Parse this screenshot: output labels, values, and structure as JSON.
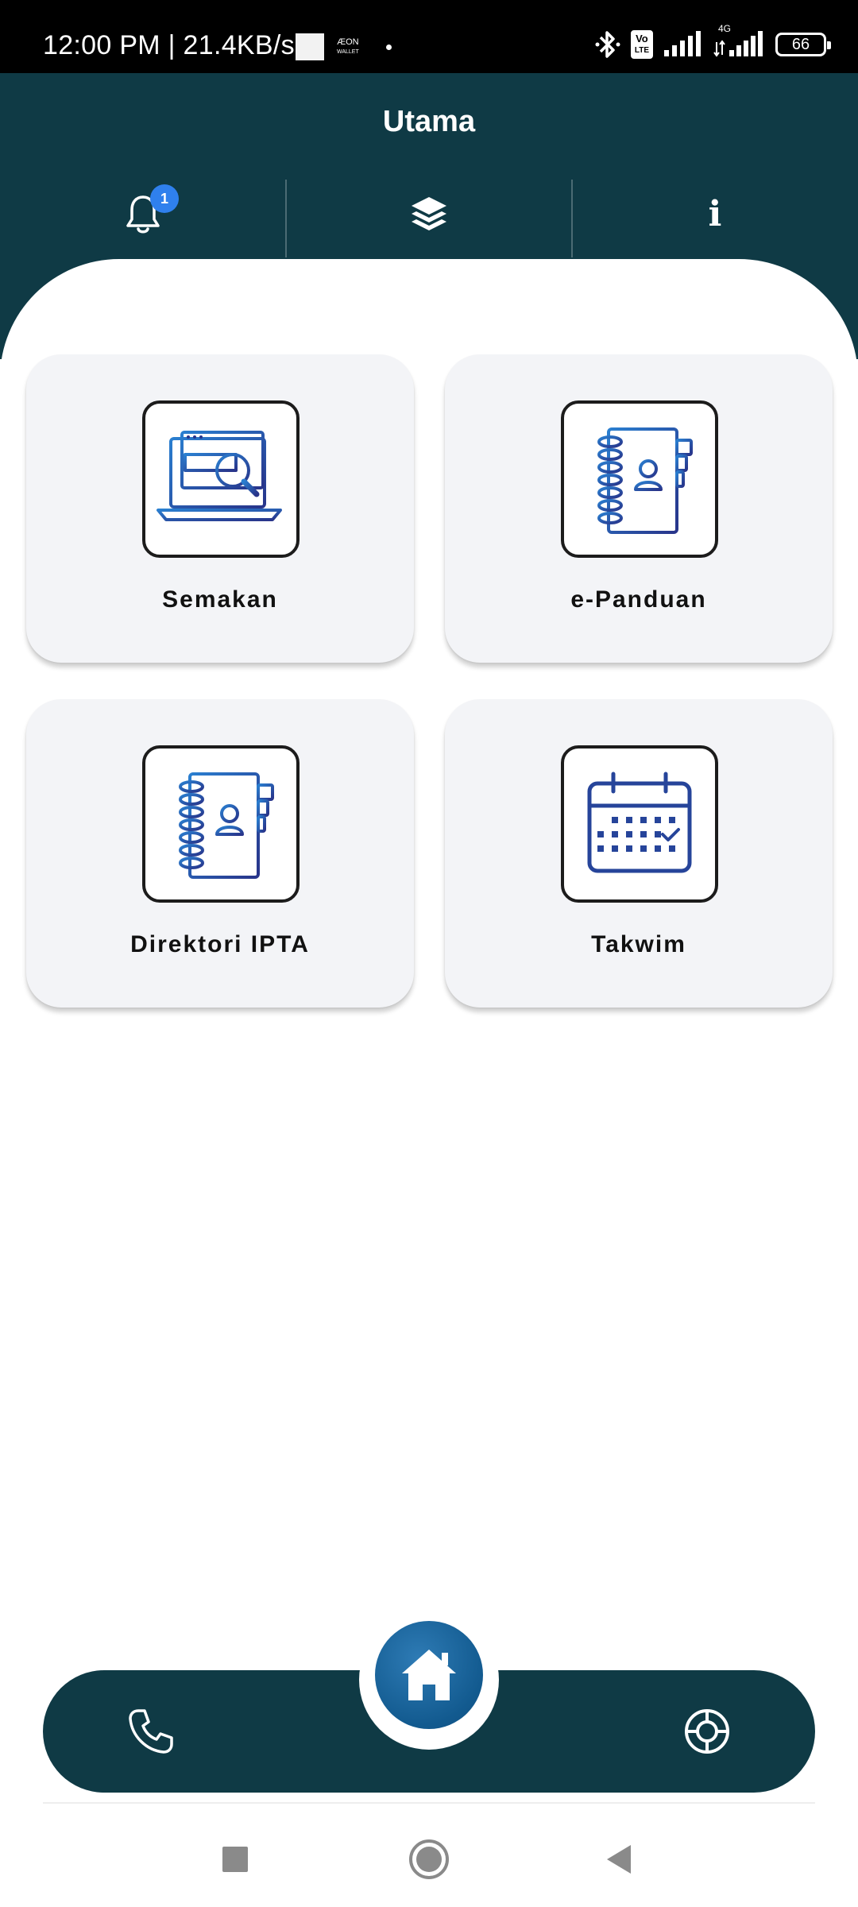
{
  "status_bar": {
    "time_speed": "12:00 PM | 21.4KB/s",
    "wallet_badge_line1": "ÆON",
    "wallet_badge_line2": "WALLET",
    "volte_line1": "Vo",
    "volte_line2": "LTE",
    "network": "4G",
    "battery": "66"
  },
  "header": {
    "title": "Utama",
    "notification_count": "1",
    "notifications_icon": "bell-icon",
    "layers_icon": "layers-icon",
    "info_icon": "info-icon",
    "info_glyph": "i"
  },
  "cards": [
    {
      "label": "Semakan",
      "icon": "laptop-search-icon"
    },
    {
      "label": "e-Panduan",
      "icon": "address-book-icon"
    },
    {
      "label": "Direktori IPTA",
      "icon": "address-book-icon"
    },
    {
      "label": "Takwim",
      "icon": "calendar-icon"
    }
  ],
  "bottom_nav": {
    "left_icon": "phone-icon",
    "center_icon": "home-icon",
    "right_icon": "lifebuoy-icon"
  },
  "colors": {
    "header_bg": "#0f3a45",
    "card_bg": "#f3f4f7",
    "badge": "#2f80ed",
    "icon_blue": "#1f4e9c",
    "fab": "#125a8f"
  }
}
